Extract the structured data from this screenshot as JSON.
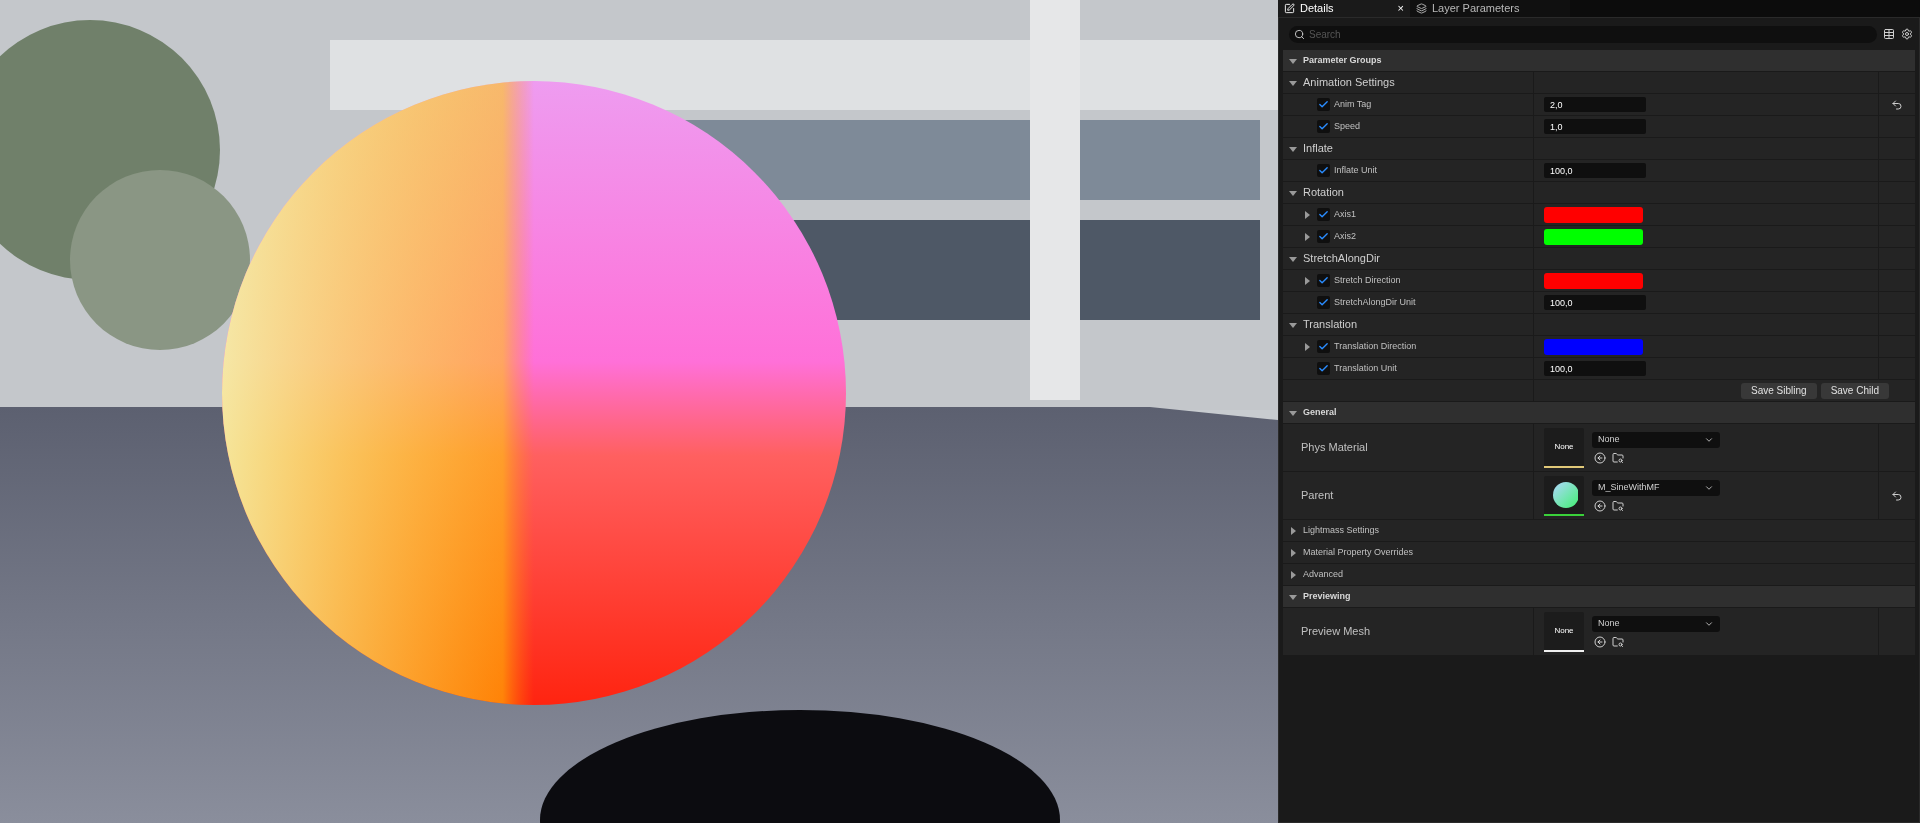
{
  "tabs": [
    {
      "label": "Details",
      "selected": true,
      "close": "×"
    },
    {
      "label": "Layer Parameters",
      "selected": false
    }
  ],
  "search": {
    "placeholder": "Search"
  },
  "sections": [
    {
      "title": "Parameter Groups",
      "expanded": true,
      "kind": "params",
      "groups": [
        {
          "name": "Animation Settings",
          "expanded": true,
          "params": [
            {
              "name": "Anim Tag",
              "checked": true,
              "kind": "number",
              "value": "2,0",
              "reset": true
            },
            {
              "name": "Speed",
              "checked": true,
              "kind": "number",
              "value": "1,0",
              "reset": false
            }
          ]
        },
        {
          "name": "Inflate",
          "expanded": true,
          "params": [
            {
              "name": "Inflate Unit",
              "checked": true,
              "kind": "number",
              "value": "100,0",
              "reset": false
            }
          ]
        },
        {
          "name": "Rotation",
          "expanded": true,
          "params": [
            {
              "name": "Axis1",
              "checked": true,
              "kind": "color",
              "color": "#ff0000",
              "expanded": false,
              "reset": false
            },
            {
              "name": "Axis2",
              "checked": true,
              "kind": "color",
              "color": "#00ff00",
              "expanded": false,
              "reset": false
            }
          ]
        },
        {
          "name": "StretchAlongDir",
          "expanded": true,
          "params": [
            {
              "name": "Stretch Direction",
              "checked": true,
              "kind": "color",
              "color": "#ff0000",
              "expanded": false,
              "reset": false
            },
            {
              "name": "StretchAlongDir Unit",
              "checked": true,
              "kind": "number",
              "value": "100,0",
              "reset": false
            }
          ]
        },
        {
          "name": "Translation",
          "expanded": true,
          "params": [
            {
              "name": "Translation Direction",
              "checked": true,
              "kind": "color",
              "color": "#0000ff",
              "expanded": false,
              "reset": false
            },
            {
              "name": "Translation Unit",
              "checked": true,
              "kind": "number",
              "value": "100,0",
              "reset": false
            }
          ]
        }
      ],
      "buttons": [
        "Save Sibling",
        "Save Child"
      ]
    },
    {
      "title": "General",
      "expanded": true,
      "kind": "properties",
      "rows": [
        {
          "kind": "asset",
          "label": "Phys Material",
          "thumbnail": {
            "kind": "text",
            "text": "None",
            "color": "#e0c878"
          },
          "value": "None",
          "reset": false
        },
        {
          "kind": "asset",
          "label": "Parent",
          "thumbnail": {
            "kind": "sphere",
            "color": "#3ad13a"
          },
          "value": "M_SineWithMF",
          "reset": true
        },
        {
          "kind": "category",
          "label": "Lightmass Settings",
          "expanded": false
        },
        {
          "kind": "category",
          "label": "Material Property Overrides",
          "expanded": false
        },
        {
          "kind": "category",
          "label": "Advanced",
          "expanded": false
        }
      ]
    },
    {
      "title": "Previewing",
      "expanded": true,
      "kind": "properties",
      "rows": [
        {
          "kind": "asset",
          "label": "Preview Mesh",
          "thumbnail": {
            "kind": "text",
            "text": "None",
            "color": "#f0f0f0"
          },
          "value": "None",
          "reset": false
        }
      ]
    }
  ]
}
